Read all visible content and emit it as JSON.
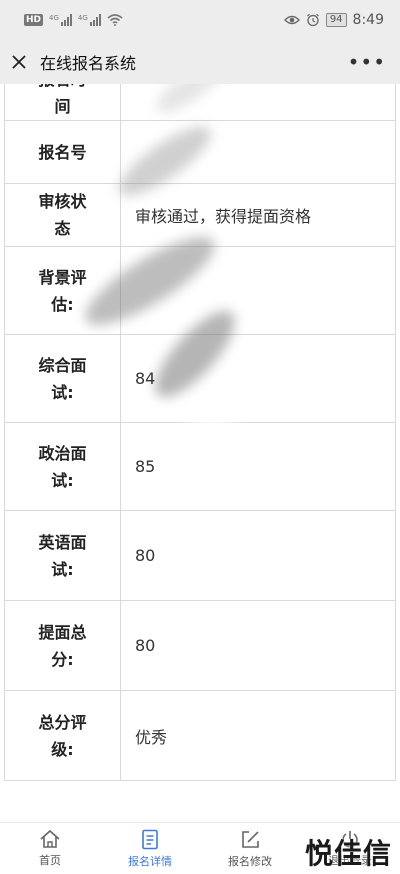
{
  "status_bar": {
    "hd_badge": "HD",
    "sim1_label": "4G",
    "sim2_label": "4G",
    "battery": "94",
    "time": "8:49"
  },
  "nav": {
    "title": "在线报名系统",
    "close_icon": "close-icon",
    "more_icon": "more-icon"
  },
  "table": {
    "rows": [
      {
        "label": "报名时间",
        "value": ""
      },
      {
        "label": "报名号",
        "value": ""
      },
      {
        "label": "审核状态",
        "value": "审核通过，获得提面资格"
      },
      {
        "label": "背景评估:",
        "value": ""
      },
      {
        "label": "综合面试:",
        "value": "84"
      },
      {
        "label": "政治面试:",
        "value": "85"
      },
      {
        "label": "英语面试:",
        "value": "80"
      },
      {
        "label": "提面总分:",
        "value": "80"
      },
      {
        "label": "总分评级:",
        "value": "优秀"
      }
    ]
  },
  "tabs": [
    {
      "label": "首页",
      "icon": "home-icon",
      "active": false
    },
    {
      "label": "报名详情",
      "icon": "document-icon",
      "active": true
    },
    {
      "label": "报名修改",
      "icon": "edit-icon",
      "active": false
    },
    {
      "label": "退出登录",
      "icon": "power-icon",
      "active": false
    }
  ],
  "watermark": "悦佳信",
  "colors": {
    "active_tab": "#3a7bd5",
    "bar_background": "#ededed",
    "border": "#d9d9d9"
  }
}
